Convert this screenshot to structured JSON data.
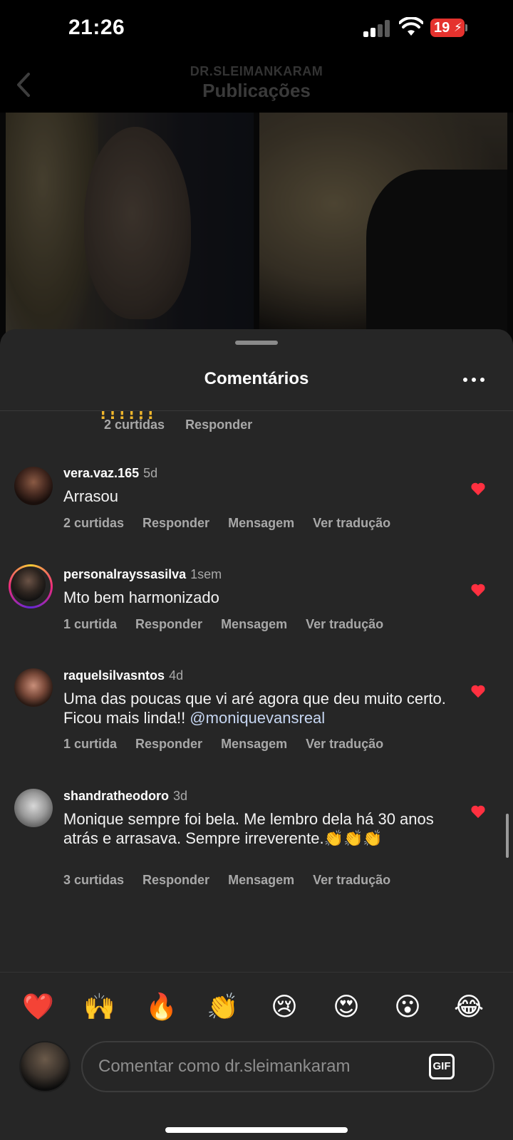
{
  "status_bar": {
    "time": "21:26",
    "battery": "19"
  },
  "header": {
    "account": "DR.SLEIMANKARAM",
    "title": "Publicações"
  },
  "sheet": {
    "title": "Comentários"
  },
  "previous_comment": {
    "likes": "2 curtidas",
    "reply": "Responder",
    "partial_text": "!!!!!!"
  },
  "comments": [
    {
      "user": "vera.vaz.165",
      "time": "5d",
      "text": "Arrasou",
      "likes": "2 curtidas",
      "reply": "Responder",
      "message": "Mensagem",
      "translate": "Ver tradução"
    },
    {
      "user": "personalrayssasilva",
      "time": "1sem",
      "text": "Mto bem harmonizado",
      "likes": "1 curtida",
      "reply": "Responder",
      "message": "Mensagem",
      "translate": "Ver tradução"
    },
    {
      "user": "raquelsilvasntos",
      "time": "4d",
      "text": "Uma das poucas que vi aré agora que deu muito certo. Ficou mais linda!! ",
      "mention": "@moniquevansreal",
      "likes": "1 curtida",
      "reply": "Responder",
      "message": "Mensagem",
      "translate": "Ver tradução"
    },
    {
      "user": "shandratheodoro",
      "time": "3d",
      "text": "Monique sempre foi bela. Me lembro dela há 30 anos atrás e arrasava. Sempre irreverente.👏👏👏",
      "likes": "3 curtidas",
      "reply": "Responder",
      "message": "Mensagem",
      "translate": "Ver tradução"
    }
  ],
  "emoji_bar": [
    "❤️",
    "🙌",
    "🔥",
    "👏",
    "😢",
    "😍",
    "😮",
    "😂"
  ],
  "composer": {
    "placeholder": "Comentar como dr.sleimankaram",
    "gif_label": "GIF"
  },
  "colors": {
    "sheet_bg": "#262626",
    "like_heart": "#ff3040",
    "muted_text": "#a8a8a8"
  }
}
